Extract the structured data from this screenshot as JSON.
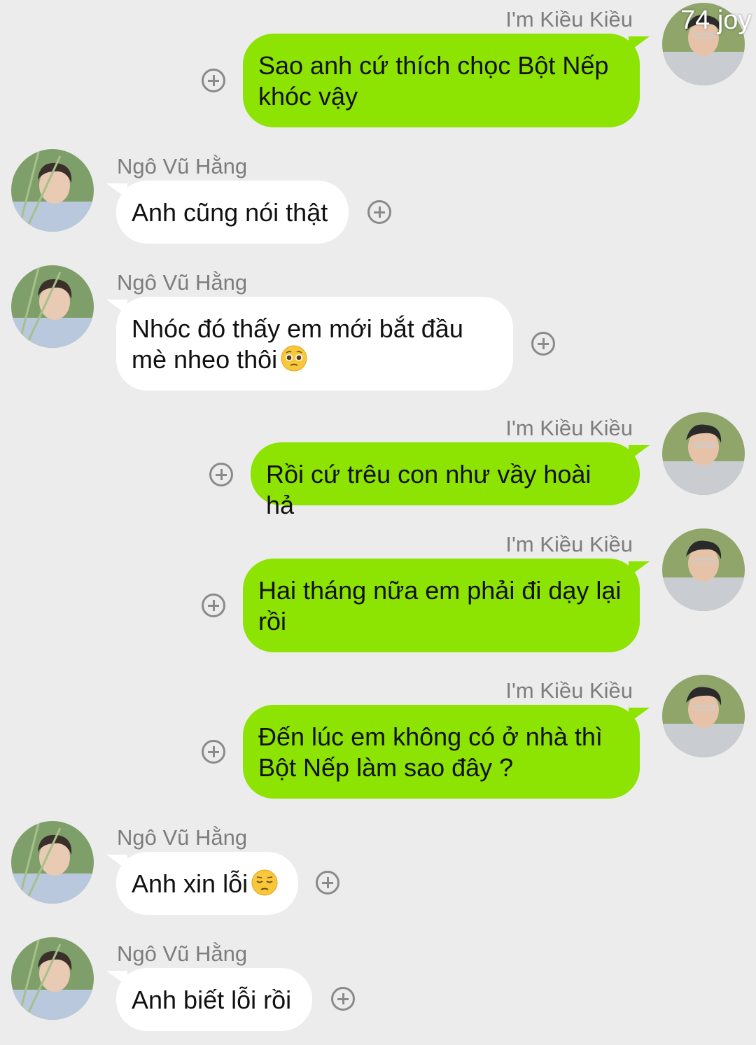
{
  "watermark": "74 joy",
  "colors": {
    "background": "#ececec",
    "outgoing_bubble": "#8de302",
    "incoming_bubble": "#ffffff",
    "sender_name": "#7d7d7d"
  },
  "messages": [
    {
      "direction": "outgoing",
      "sender": "I'm Kiều Kiều",
      "lines": [
        "Sao anh cứ thích chọc Bột Nếp",
        "khóc vậy"
      ],
      "emoji": ""
    },
    {
      "direction": "incoming",
      "sender": "Ngô Vũ Hằng",
      "lines": [
        "Anh cũng nói thật"
      ],
      "emoji": ""
    },
    {
      "direction": "incoming",
      "sender": "Ngô Vũ Hằng",
      "lines": [
        "Nhóc đó thấy em mới bắt đầu",
        "mè nheo thôi"
      ],
      "emoji": "pleading-face-emoji"
    },
    {
      "direction": "outgoing",
      "sender": "I'm Kiều Kiều",
      "lines": [
        "Rồi cứ trêu con như vầy hoài hả"
      ],
      "emoji": ""
    },
    {
      "direction": "outgoing",
      "sender": "I'm Kiều Kiều",
      "lines": [
        "Hai tháng nữa em phải đi dạy lại",
        "rồi"
      ],
      "emoji": ""
    },
    {
      "direction": "outgoing",
      "sender": "I'm Kiều Kiều",
      "lines": [
        "Đến lúc em không có ở nhà thì",
        "Bột Nếp làm sao đây ?"
      ],
      "emoji": ""
    },
    {
      "direction": "incoming",
      "sender": "Ngô Vũ Hằng",
      "lines": [
        "Anh xin lỗi"
      ],
      "emoji": "pensive-face-emoji"
    },
    {
      "direction": "incoming",
      "sender": "Ngô Vũ Hằng",
      "lines": [
        "Anh biết lỗi rồi"
      ],
      "emoji": ""
    }
  ]
}
